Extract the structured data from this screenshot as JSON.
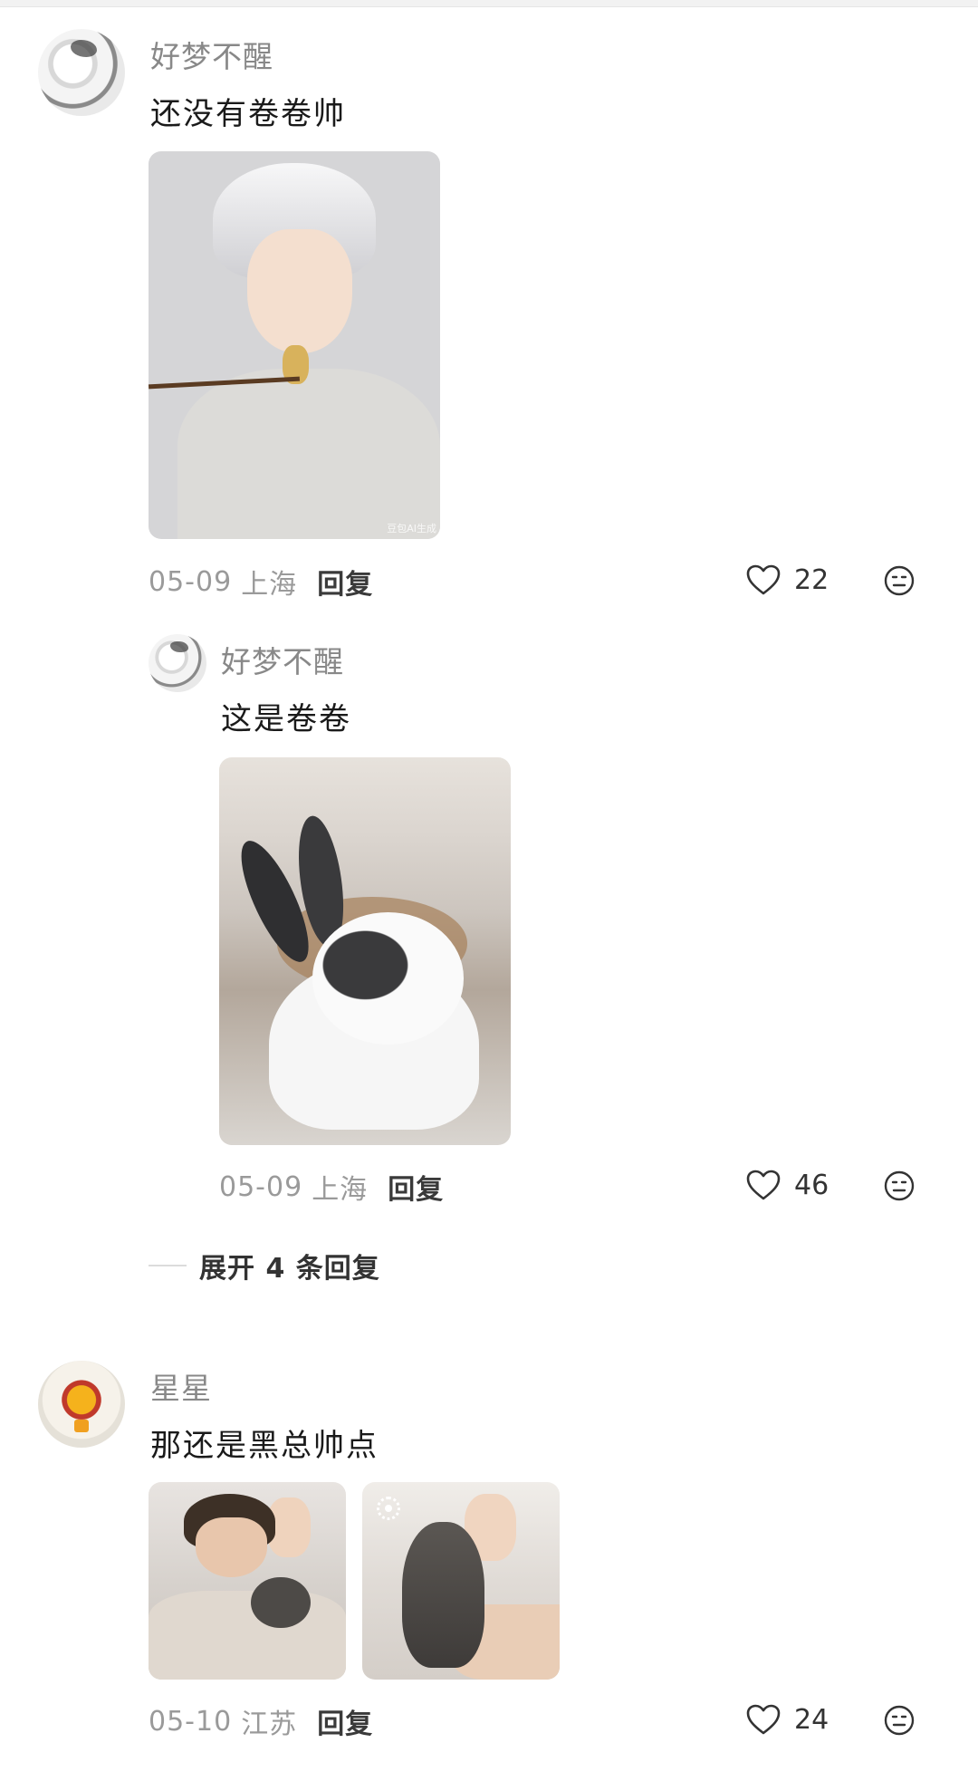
{
  "comments": [
    {
      "username": "好梦不醒",
      "text": "还没有卷卷帅",
      "date": "05-09",
      "location": "上海",
      "reply_label": "回复",
      "likes": "22",
      "image_watermark": "豆包AI生成",
      "replies": [
        {
          "username": "好梦不醒",
          "text": "这是卷卷",
          "date": "05-09",
          "location": "上海",
          "reply_label": "回复",
          "likes": "46"
        }
      ],
      "expand_label": "展开 4 条回复"
    },
    {
      "username": "星星",
      "text": "那还是黑总帅点",
      "date": "05-10",
      "location": "江苏",
      "reply_label": "回复",
      "likes": "24"
    }
  ],
  "icons": {
    "like": "heart-outline-icon",
    "emoji": "emoji-face-icon",
    "live_photo": "live-photo-icon"
  },
  "colors": {
    "background": "#ffffff",
    "username": "#888888",
    "text": "#1a1a1a",
    "meta": "#9a9a9a"
  }
}
